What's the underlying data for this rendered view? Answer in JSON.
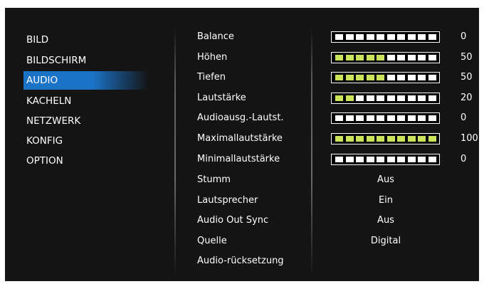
{
  "left_menu": {
    "items": [
      "BILD",
      "BILDSCHIRM",
      "AUDIO",
      "KACHELN",
      "NETZWERK",
      "KONFIG",
      "OPTION"
    ],
    "selected": "AUDIO"
  },
  "settings": {
    "balance": {
      "label": "Balance",
      "value": "0",
      "level_segments": 0
    },
    "hoehen": {
      "label": "Höhen",
      "value": "50",
      "level_segments": 5
    },
    "tiefen": {
      "label": "Tiefen",
      "value": "50",
      "level_segments": 5
    },
    "lautstaerke": {
      "label": "Lautstärke",
      "value": "20",
      "level_segments": 2
    },
    "audioausg": {
      "label": "Audioausg.-Lautst.",
      "value": "0",
      "level_segments": 0
    },
    "maximal": {
      "label": "Maximallautstärke",
      "value": "100",
      "level_segments": 10
    },
    "minimal": {
      "label": "Minimallautstärke",
      "value": "0",
      "level_segments": 0
    },
    "stumm": {
      "label": "Stumm",
      "value": "Aus"
    },
    "lautsprecher": {
      "label": "Lautsprecher",
      "value": "Ein"
    },
    "audio_out_sync": {
      "label": "Audio Out Sync",
      "value": "Aus"
    },
    "quelle": {
      "label": "Quelle",
      "value": "Digital"
    },
    "reset": {
      "label": "Audio-rücksetzung"
    }
  },
  "colors": {
    "background": "#141414",
    "selected_highlight": "#1b73c8",
    "bar_active_segment": "#c9e35a",
    "bar_inactive_segment": "#ffffff"
  }
}
